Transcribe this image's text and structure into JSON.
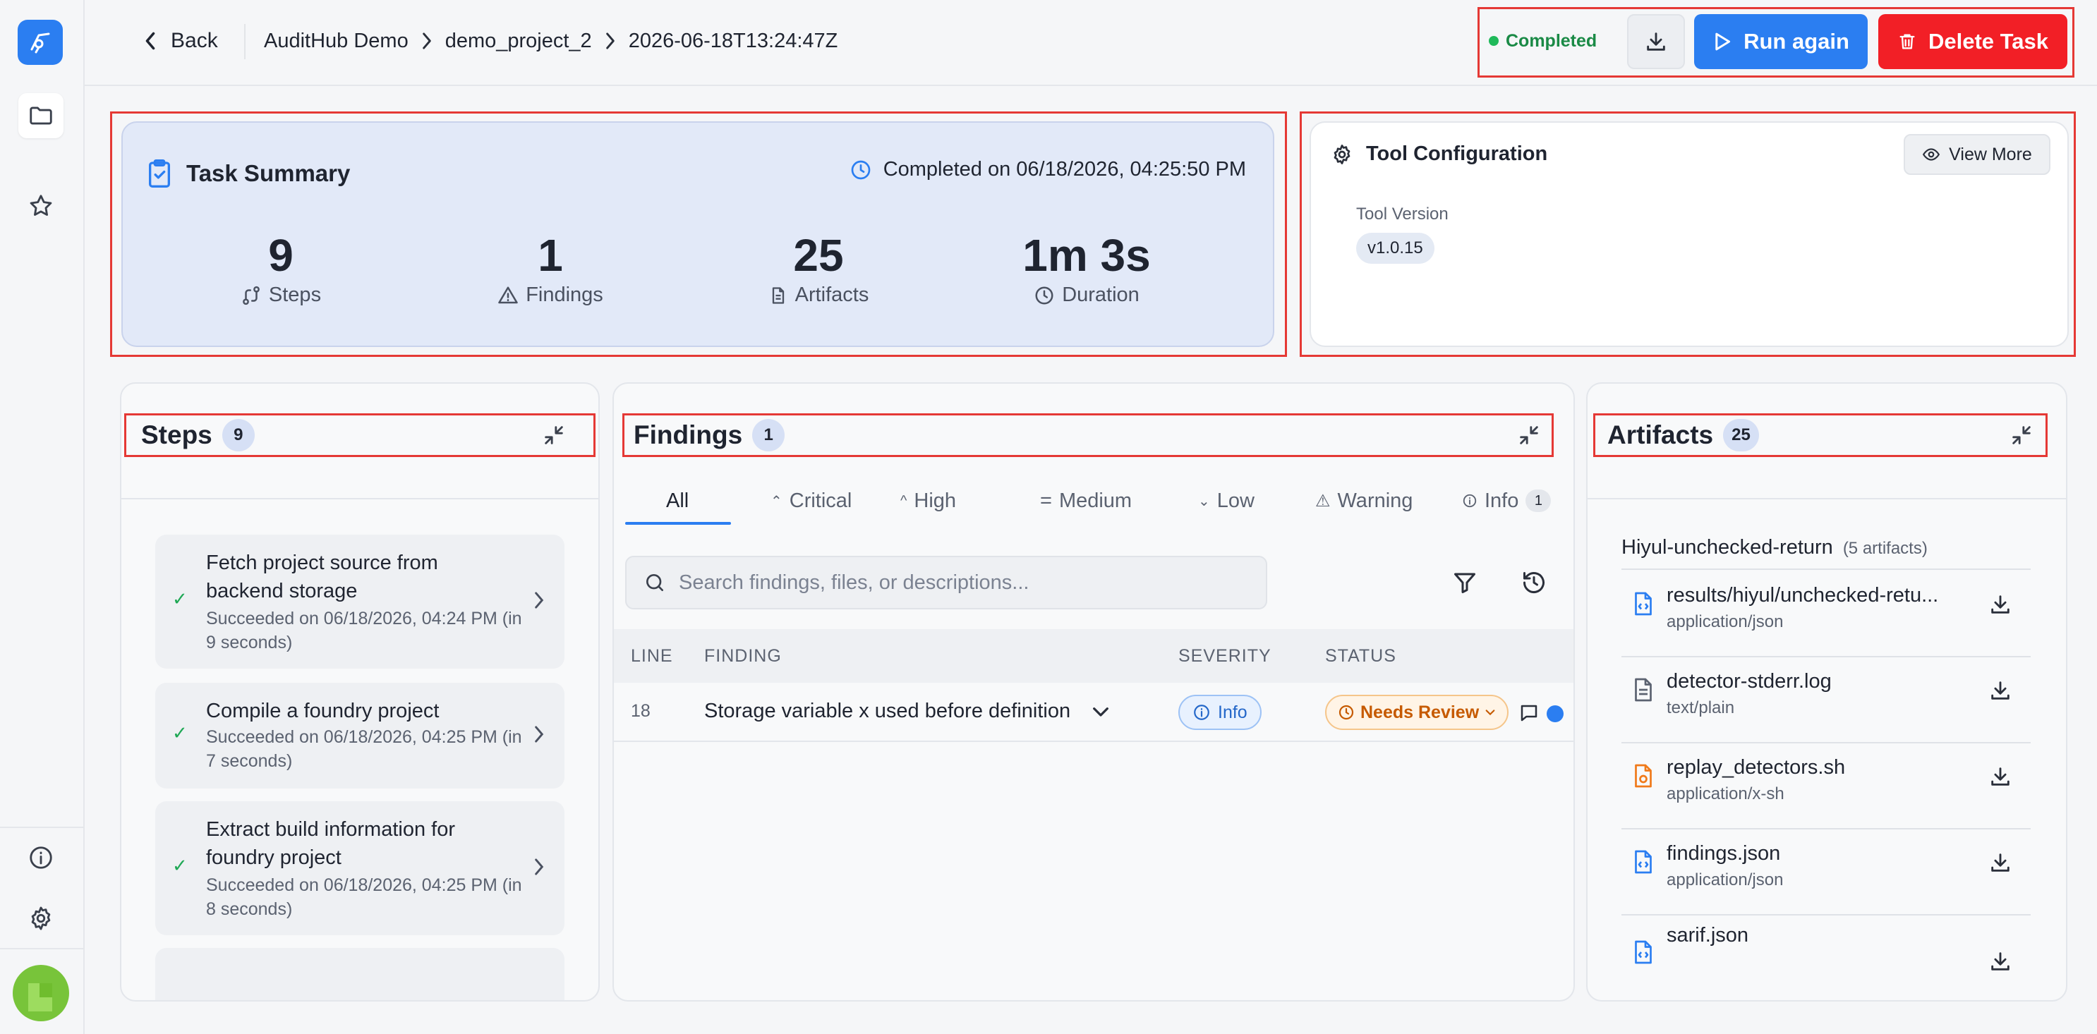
{
  "header": {
    "back_label": "Back",
    "breadcrumbs": [
      "AuditHub Demo",
      "demo_project_2",
      "2026-06-18T13:24:47Z"
    ],
    "status": "Completed",
    "run_again": "Run again",
    "delete_task": "Delete Task"
  },
  "summary": {
    "title": "Task Summary",
    "completed_on": "Completed on 06/18/2026, 04:25:50 PM",
    "stats": [
      {
        "value": "9",
        "label": "Steps"
      },
      {
        "value": "1",
        "label": "Findings"
      },
      {
        "value": "25",
        "label": "Artifacts"
      },
      {
        "value": "1m 3s",
        "label": "Duration"
      }
    ]
  },
  "tool_config": {
    "title": "Tool Configuration",
    "view_more": "View More",
    "version_label": "Tool Version",
    "version": "v1.0.15"
  },
  "steps": {
    "title": "Steps",
    "count": "9",
    "items": [
      {
        "title": "Fetch project source from backend storage",
        "sub": "Succeeded on 06/18/2026, 04:24 PM (in 9 seconds)"
      },
      {
        "title": "Compile a foundry project",
        "sub": "Succeeded on 06/18/2026, 04:25 PM (in 7 seconds)"
      },
      {
        "title": "Extract build information for foundry project",
        "sub": "Succeeded on 06/18/2026, 04:25 PM (in 8 seconds)"
      }
    ]
  },
  "findings": {
    "title": "Findings",
    "count": "1",
    "tabs": [
      "All",
      "Critical",
      "High",
      "Medium",
      "Low",
      "Warning",
      "Info"
    ],
    "info_count": "1",
    "search_placeholder": "Search findings, files, or descriptions...",
    "columns": [
      "LINE",
      "FINDING",
      "SEVERITY",
      "STATUS"
    ],
    "rows": [
      {
        "line": "18",
        "finding": "Storage variable x used before definition",
        "severity": "Info",
        "status": "Needs Review"
      }
    ]
  },
  "artifacts": {
    "title": "Artifacts",
    "count": "25",
    "group_name": "Hiyul-unchecked-return",
    "group_count": "(5 artifacts)",
    "items": [
      {
        "name": "results/hiyul/unchecked-retu...",
        "type": "application/json",
        "icon": "json-file-icon"
      },
      {
        "name": "detector-stderr.log",
        "type": "text/plain",
        "icon": "text-file-icon"
      },
      {
        "name": "replay_detectors.sh",
        "type": "application/x-sh",
        "icon": "script-file-icon"
      },
      {
        "name": "findings.json",
        "type": "application/json",
        "icon": "json-file-icon"
      },
      {
        "name": "sarif.json",
        "type": "",
        "icon": "json-file-icon"
      }
    ]
  },
  "colors": {
    "primary": "#2b7ef1",
    "danger": "#f21f26",
    "success": "#1fb95a",
    "summary_bg": "#e2e9f8"
  }
}
